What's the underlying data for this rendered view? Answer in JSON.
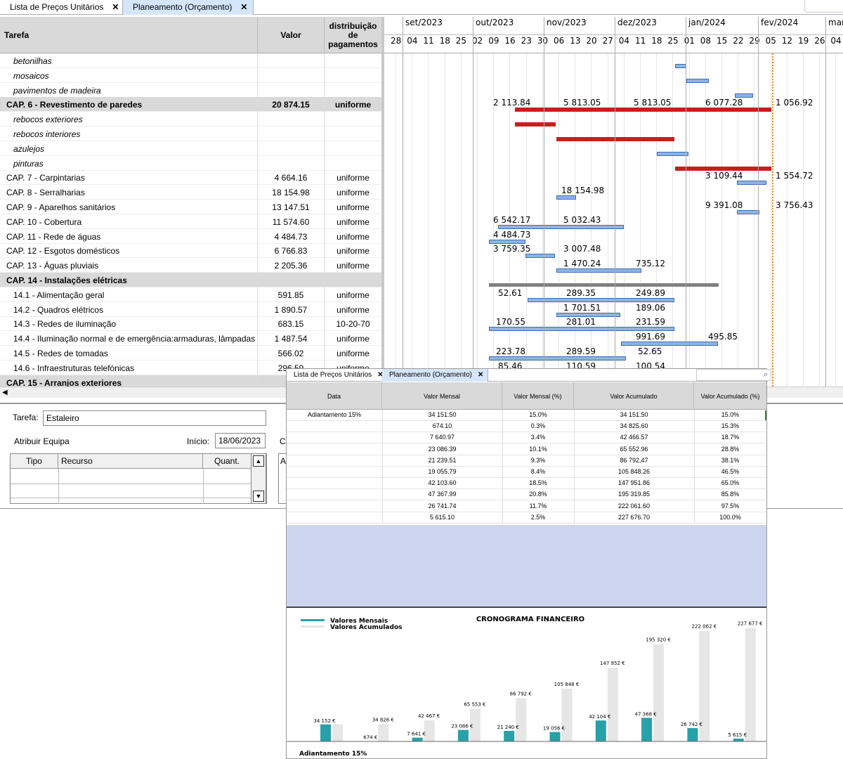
{
  "tabs": {
    "tab1": "Lista de Preços Unitários",
    "tab2": "Planeamento (Orçamento)",
    "close": "✕"
  },
  "grid": {
    "headers": {
      "task": "Tarefa",
      "value": "Valor",
      "dist": "distribuição de pagamentos"
    },
    "rows": [
      {
        "name": "betonilhas",
        "value": "",
        "dist": "",
        "kind": "sub"
      },
      {
        "name": "mosaicos",
        "value": "",
        "dist": "",
        "kind": "sub"
      },
      {
        "name": "pavimentos de madeira",
        "value": "",
        "dist": "",
        "kind": "sub"
      },
      {
        "name": "CAP. 6 - Revestimento de paredes",
        "value": "20 874.15",
        "dist": "uniforme",
        "kind": "chapter"
      },
      {
        "name": "rebocos exteriores",
        "value": "",
        "dist": "",
        "kind": "sub"
      },
      {
        "name": "rebocos interiores",
        "value": "",
        "dist": "",
        "kind": "sub"
      },
      {
        "name": "azulejos",
        "value": "",
        "dist": "",
        "kind": "sub"
      },
      {
        "name": "pinturas",
        "value": "",
        "dist": "",
        "kind": "sub"
      },
      {
        "name": "CAP. 7 - Carpintarias",
        "value": "4 664.16",
        "dist": "uniforme",
        "kind": "normal"
      },
      {
        "name": "CAP. 8 - Serralharias",
        "value": "18 154.98",
        "dist": "uniforme",
        "kind": "normal"
      },
      {
        "name": "CAP. 9 - Aparelhos sanitários",
        "value": "13 147.51",
        "dist": "uniforme",
        "kind": "normal"
      },
      {
        "name": "CAP. 10 - Cobertura",
        "value": "11 574.60",
        "dist": "uniforme",
        "kind": "normal"
      },
      {
        "name": "CAP. 11 - Rede de águas",
        "value": "4 484.73",
        "dist": "uniforme",
        "kind": "normal"
      },
      {
        "name": "CAP. 12 - Esgotos domésticos",
        "value": "6 766.83",
        "dist": "uniforme",
        "kind": "normal"
      },
      {
        "name": "CAP. 13 - Águas pluviais",
        "value": "2 205.36",
        "dist": "uniforme",
        "kind": "normal"
      },
      {
        "name": "CAP. 14 - Instalações elétricas",
        "value": "",
        "dist": "",
        "kind": "chapter"
      },
      {
        "name": "14.1 - Alimentação geral",
        "value": "591.85",
        "dist": "uniforme",
        "kind": "ind"
      },
      {
        "name": "14.2 - Quadros elétricos",
        "value": "1 890.57",
        "dist": "uniforme",
        "kind": "ind"
      },
      {
        "name": "14.3 - Redes de iluminação",
        "value": "683.15",
        "dist": "10-20-70",
        "kind": "ind"
      },
      {
        "name": "14.4 - Iluminação normal e de emergência:armaduras, lâmpadas",
        "value": "1 487.54",
        "dist": "uniforme",
        "kind": "ind"
      },
      {
        "name": "14.5 - Redes de tomadas",
        "value": "566.02",
        "dist": "uniforme",
        "kind": "ind"
      },
      {
        "name": "14.6 - Infraestruturas telefónicas",
        "value": "296.59",
        "dist": "uniforme",
        "kind": "ind"
      },
      {
        "name": "CAP. 15 - Arranjos exteriores",
        "value": "",
        "dist": "",
        "kind": "chapter"
      }
    ]
  },
  "gantt": {
    "months": [
      "set/2023",
      "out/2023",
      "nov/2023",
      "dez/2023",
      "jan/2024",
      "fev/2024",
      "mar"
    ],
    "weeks": [
      "28",
      "04",
      "11",
      "18",
      "25",
      "02",
      "09",
      "16",
      "23",
      "30",
      "06",
      "13",
      "20",
      "27",
      "04",
      "11",
      "18",
      "25",
      "01",
      "08",
      "15",
      "22",
      "29",
      "05",
      "12",
      "19",
      "26",
      "04"
    ],
    "labels": [
      {
        "row": 3,
        "items": [
          [
            155,
            "2 113.84"
          ],
          [
            255,
            "5 813.05"
          ],
          [
            355,
            "5 813.05"
          ],
          [
            457,
            "6 077.28"
          ],
          [
            557,
            "1 056.92"
          ]
        ]
      },
      {
        "row": 8,
        "items": [
          [
            457,
            "3 109.44"
          ],
          [
            557,
            "1 554.72"
          ]
        ]
      },
      {
        "row": 9,
        "items": [
          [
            252,
            "18 154.98"
          ]
        ]
      },
      {
        "row": 10,
        "items": [
          [
            457,
            "9 391.08"
          ],
          [
            557,
            "3 756.43"
          ]
        ]
      },
      {
        "row": 11,
        "items": [
          [
            155,
            "6 542.17"
          ],
          [
            255,
            "5 032.43"
          ]
        ]
      },
      {
        "row": 12,
        "items": [
          [
            155,
            "4 484.73"
          ]
        ]
      },
      {
        "row": 13,
        "items": [
          [
            155,
            "3 759.35"
          ],
          [
            255,
            "3 007.48"
          ]
        ]
      },
      {
        "row": 14,
        "items": [
          [
            255,
            "1 470.24"
          ],
          [
            358,
            "735.12"
          ]
        ]
      },
      {
        "row": 16,
        "items": [
          [
            162,
            "52.61"
          ],
          [
            259,
            "289.35"
          ],
          [
            358,
            "249.89"
          ]
        ]
      },
      {
        "row": 17,
        "items": [
          [
            255,
            "1 701.51"
          ],
          [
            358,
            "189.06"
          ]
        ]
      },
      {
        "row": 18,
        "items": [
          [
            159,
            "170.55"
          ],
          [
            259,
            "281.01"
          ],
          [
            358,
            "231.59"
          ]
        ]
      },
      {
        "row": 19,
        "items": [
          [
            358,
            "991.69"
          ],
          [
            461,
            "495.85"
          ]
        ]
      },
      {
        "row": 20,
        "items": [
          [
            159,
            "223.78"
          ],
          [
            259,
            "289.59"
          ],
          [
            361,
            "52.65"
          ]
        ]
      },
      {
        "row": 21,
        "items": [
          [
            162,
            "85.46"
          ],
          [
            259,
            "110.59"
          ],
          [
            358,
            "100.54"
          ]
        ]
      }
    ]
  },
  "form": {
    "task_label": "Tarefa:",
    "task_value": "Estaleiro",
    "team_label": "Atribuir Equipa",
    "start_label": "Início:",
    "start_value": "18/06/2023",
    "cols": {
      "tipo": "Tipo",
      "recurso": "Recurso",
      "quant": "Quant."
    }
  },
  "overlay": {
    "headers": {
      "date": "Data",
      "monthly": "Valor Mensal",
      "monthly_pct": "Valor Mensal (%)",
      "cumulative": "Valor Acumulado",
      "cumulative_pct": "Valor Acumulado (%)"
    },
    "rows": [
      {
        "date": "Adiantamento 15%",
        "monthly": "34 151.50",
        "monthly_pct": "15.0%",
        "cumulative": "34 151.50",
        "cumulative_pct": "15.0%"
      },
      {
        "date": "",
        "monthly": "674.10",
        "monthly_pct": "0.3%",
        "cumulative": "34 825.60",
        "cumulative_pct": "15.3%"
      },
      {
        "date": "",
        "monthly": "7 640.97",
        "monthly_pct": "3.4%",
        "cumulative": "42 466.57",
        "cumulative_pct": "18.7%"
      },
      {
        "date": "",
        "monthly": "23 086.39",
        "monthly_pct": "10.1%",
        "cumulative": "65 552.96",
        "cumulative_pct": "28.8%"
      },
      {
        "date": "",
        "monthly": "21 239.51",
        "monthly_pct": "9.3%",
        "cumulative": "86 792.47",
        "cumulative_pct": "38.1%"
      },
      {
        "date": "",
        "monthly": "19 055.79",
        "monthly_pct": "8.4%",
        "cumulative": "105 848.26",
        "cumulative_pct": "46.5%"
      },
      {
        "date": "",
        "monthly": "42 103.60",
        "monthly_pct": "18.5%",
        "cumulative": "147 951.86",
        "cumulative_pct": "65.0%"
      },
      {
        "date": "",
        "monthly": "47 367.99",
        "monthly_pct": "20.8%",
        "cumulative": "195 319.85",
        "cumulative_pct": "85.8%"
      },
      {
        "date": "",
        "monthly": "26 741.74",
        "monthly_pct": "11.7%",
        "cumulative": "222 061.60",
        "cumulative_pct": "97.5%"
      },
      {
        "date": "",
        "monthly": "5 615.10",
        "monthly_pct": "2.5%",
        "cumulative": "227 676.70",
        "cumulative_pct": "100.0%"
      }
    ]
  },
  "chart_data": {
    "type": "bar",
    "title": "CRONOGRAMA FINANCEIRO",
    "legend_position": "top-left",
    "first_category": "Adiantamento 15%",
    "colors": {
      "monthly": "#2aa0a8",
      "cumulative": "#e6e6e6"
    },
    "series": [
      {
        "name": "Valores Mensais",
        "values": [
          34152,
          674,
          7641,
          23086,
          21240,
          19056,
          42104,
          47368,
          26742,
          5615
        ],
        "labels": [
          "34 152 €",
          "674 €",
          "7 641 €",
          "23 086 €",
          "21 240 €",
          "19 056 €",
          "42 104 €",
          "47 368 €",
          "26 742 €",
          "5 615 €"
        ]
      },
      {
        "name": "Valores Acumulados",
        "values": [
          34152,
          34826,
          42467,
          65553,
          86792,
          105848,
          147952,
          195320,
          222062,
          227677
        ],
        "labels": [
          "",
          "34 826 €",
          "42 467 €",
          "65 553 €",
          "86 792 €",
          "105 848 €",
          "147 952 €",
          "195 320 €",
          "222 062 €",
          "227 677 €"
        ]
      }
    ],
    "ylim": [
      0,
      240000
    ]
  }
}
